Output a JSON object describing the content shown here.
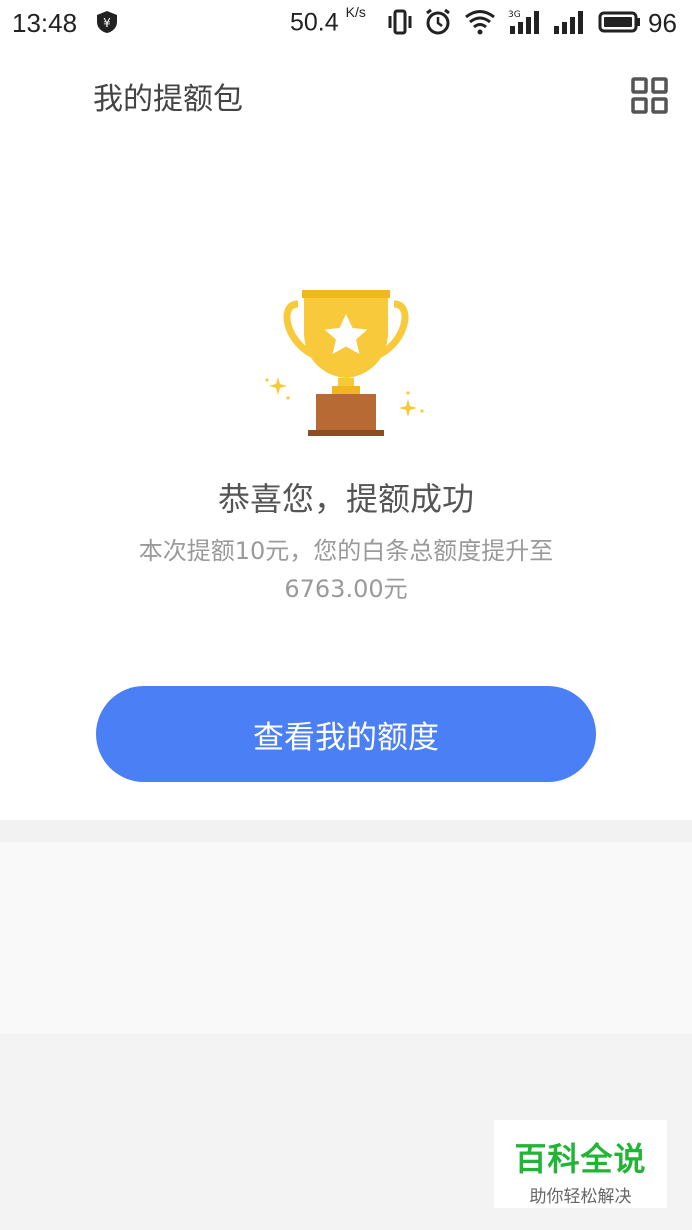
{
  "status_bar": {
    "time": "13:48",
    "net_speed": "50.4",
    "net_speed_unit": "K/s",
    "signal_label": "3G",
    "battery": "96"
  },
  "header": {
    "title": "我的提额包"
  },
  "result": {
    "title": "恭喜您，提额成功",
    "description": "本次提额10元，您的白条总额度提升至6763.00元"
  },
  "actions": {
    "view_limit_label": "查看我的额度"
  },
  "watermark": {
    "main": "百科全说",
    "sub": "助你轻松解决"
  },
  "colors": {
    "accent": "#4a7ff5",
    "trophy_gold": "#f8c93a",
    "trophy_base": "#b86a35",
    "watermark_green": "#22b535"
  }
}
